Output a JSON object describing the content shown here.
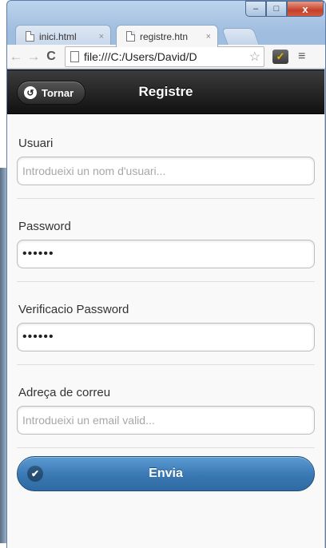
{
  "browser": {
    "tabs": [
      {
        "label": "inici.html",
        "close": "×"
      },
      {
        "label": "registre.htn",
        "close": "×"
      }
    ],
    "controls": {
      "minimize": "–",
      "maximize": "□",
      "close": "x"
    },
    "toolbar": {
      "back": "←",
      "forward": "→",
      "reload": "C",
      "url": "file:///C:/Users/David/D",
      "star": "☆",
      "menu": "≡"
    }
  },
  "header": {
    "title": "Registre",
    "back_label": "Tornar",
    "back_icon": "↺"
  },
  "form": {
    "fields": [
      {
        "label": "Usuari",
        "value": "",
        "placeholder": "Introdueixi un nom d'usuari..."
      },
      {
        "label": "Password",
        "value": "••••••",
        "placeholder": ""
      },
      {
        "label": "Verificacio Password",
        "value": "••••••",
        "placeholder": ""
      },
      {
        "label": "Adreça de correu",
        "value": "",
        "placeholder": "Introdueixi un email valid..."
      }
    ],
    "submit_label": "Envia",
    "submit_icon": "✔"
  },
  "colors": {
    "header_bg": "#1e1e1e",
    "submit_bg": "#3a78b3",
    "page_bg": "#f9f9f9"
  }
}
